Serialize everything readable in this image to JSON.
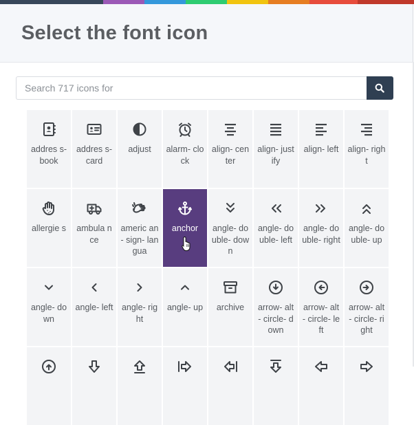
{
  "title": "Select the font icon",
  "search": {
    "placeholder": "Search 717 icons for",
    "button_icon": "search-icon"
  },
  "accent_stripe": [
    "#37475a",
    "#9b59b6",
    "#3498db",
    "#2ecc71",
    "#f1c40f",
    "#e67e22",
    "#e74c3c",
    "#c0392b"
  ],
  "colors": {
    "selected_tile": "#583d7f",
    "tile": "#f3f4f6",
    "search_button": "#2f3f52"
  },
  "icons": [
    {
      "name": "address-book",
      "label": "addres s-book"
    },
    {
      "name": "address-card",
      "label": "addres s-card"
    },
    {
      "name": "adjust",
      "label": "adjust"
    },
    {
      "name": "alarm-clock",
      "label": "alarm- clock"
    },
    {
      "name": "align-center",
      "label": "align- center"
    },
    {
      "name": "align-justify",
      "label": "align- justify"
    },
    {
      "name": "align-left",
      "label": "align- left"
    },
    {
      "name": "align-right",
      "label": "align- right"
    },
    {
      "name": "allergies",
      "label": "allergie s"
    },
    {
      "name": "ambulance",
      "label": "ambula nce"
    },
    {
      "name": "american-sign-language",
      "label": "americ an- sign- langua"
    },
    {
      "name": "anchor",
      "label": "anchor",
      "selected": true
    },
    {
      "name": "angle-double-down",
      "label": "angle- double- down"
    },
    {
      "name": "angle-double-left",
      "label": "angle- double- left"
    },
    {
      "name": "angle-double-right",
      "label": "angle- double- right"
    },
    {
      "name": "angle-double-up",
      "label": "angle- double- up"
    },
    {
      "name": "angle-down",
      "label": "angle- down"
    },
    {
      "name": "angle-left",
      "label": "angle- left"
    },
    {
      "name": "angle-right",
      "label": "angle- right"
    },
    {
      "name": "angle-up",
      "label": "angle- up"
    },
    {
      "name": "archive",
      "label": "archive"
    },
    {
      "name": "arrow-alt-circle-down",
      "label": "arrow- alt- circle- down"
    },
    {
      "name": "arrow-alt-circle-left",
      "label": "arrow- alt- circle- left"
    },
    {
      "name": "arrow-alt-circle-right",
      "label": "arrow- alt- circle- right"
    },
    {
      "name": "arrow-alt-circle-up",
      "label": ""
    },
    {
      "name": "arrow-alt-down",
      "label": ""
    },
    {
      "name": "arrow-alt-from-bottom",
      "label": ""
    },
    {
      "name": "arrow-alt-from-left",
      "label": ""
    },
    {
      "name": "arrow-alt-from-right",
      "label": ""
    },
    {
      "name": "arrow-alt-from-top",
      "label": ""
    },
    {
      "name": "arrow-alt-left",
      "label": ""
    },
    {
      "name": "arrow-alt-right",
      "label": ""
    }
  ]
}
